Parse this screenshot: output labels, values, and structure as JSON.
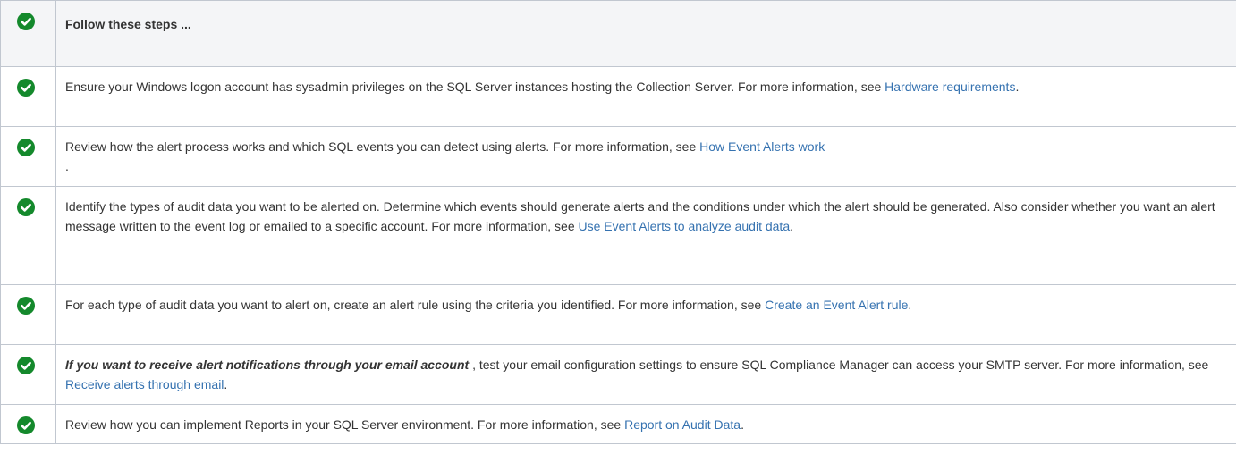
{
  "header": {
    "icon": "check-circle-icon",
    "title": "Follow these steps ..."
  },
  "steps": [
    {
      "icon": "check-circle-icon",
      "text": "Ensure your Windows logon account has sysadmin privileges on the SQL Server instances hosting the Collection Server. For more information, see ",
      "link": "Hardware requirements",
      "suffix": "."
    },
    {
      "icon": "check-circle-icon",
      "text": "Review how the alert process works and which SQL events you can detect using alerts. For more information, see ",
      "link": "How Event Alerts work",
      "suffix": " ."
    },
    {
      "icon": "check-circle-icon",
      "text": "Identify the types of audit data you want to be alerted on. Determine which events should generate alerts and the conditions under which the alert should be generated. Also consider whether you want an alert message written to the event log or emailed to a specific account. For more information, see ",
      "link": "Use Event Alerts to analyze audit data",
      "suffix": "."
    },
    {
      "icon": "check-circle-icon",
      "text": "For each type of audit data you want to alert on, create an alert rule using the criteria you identified. For more information, see ",
      "link": "Create an Event Alert rule",
      "suffix": "."
    },
    {
      "icon": "check-circle-icon",
      "emphasis": "If you want to receive alert notifications through your email account",
      "text": " , test your email configuration settings to ensure SQL Compliance Manager can access your SMTP server. For more information, see ",
      "link": "Receive alerts through email",
      "suffix": "."
    },
    {
      "icon": "check-circle-icon",
      "text": "Review how you can implement Reports in your SQL Server environment. For more information, see ",
      "link": "Report on Audit Data",
      "suffix": "."
    }
  ],
  "colors": {
    "check_green": "#14892c",
    "link_blue": "#3572b0",
    "header_bg": "#f4f5f7",
    "border": "#c1c7d0"
  }
}
